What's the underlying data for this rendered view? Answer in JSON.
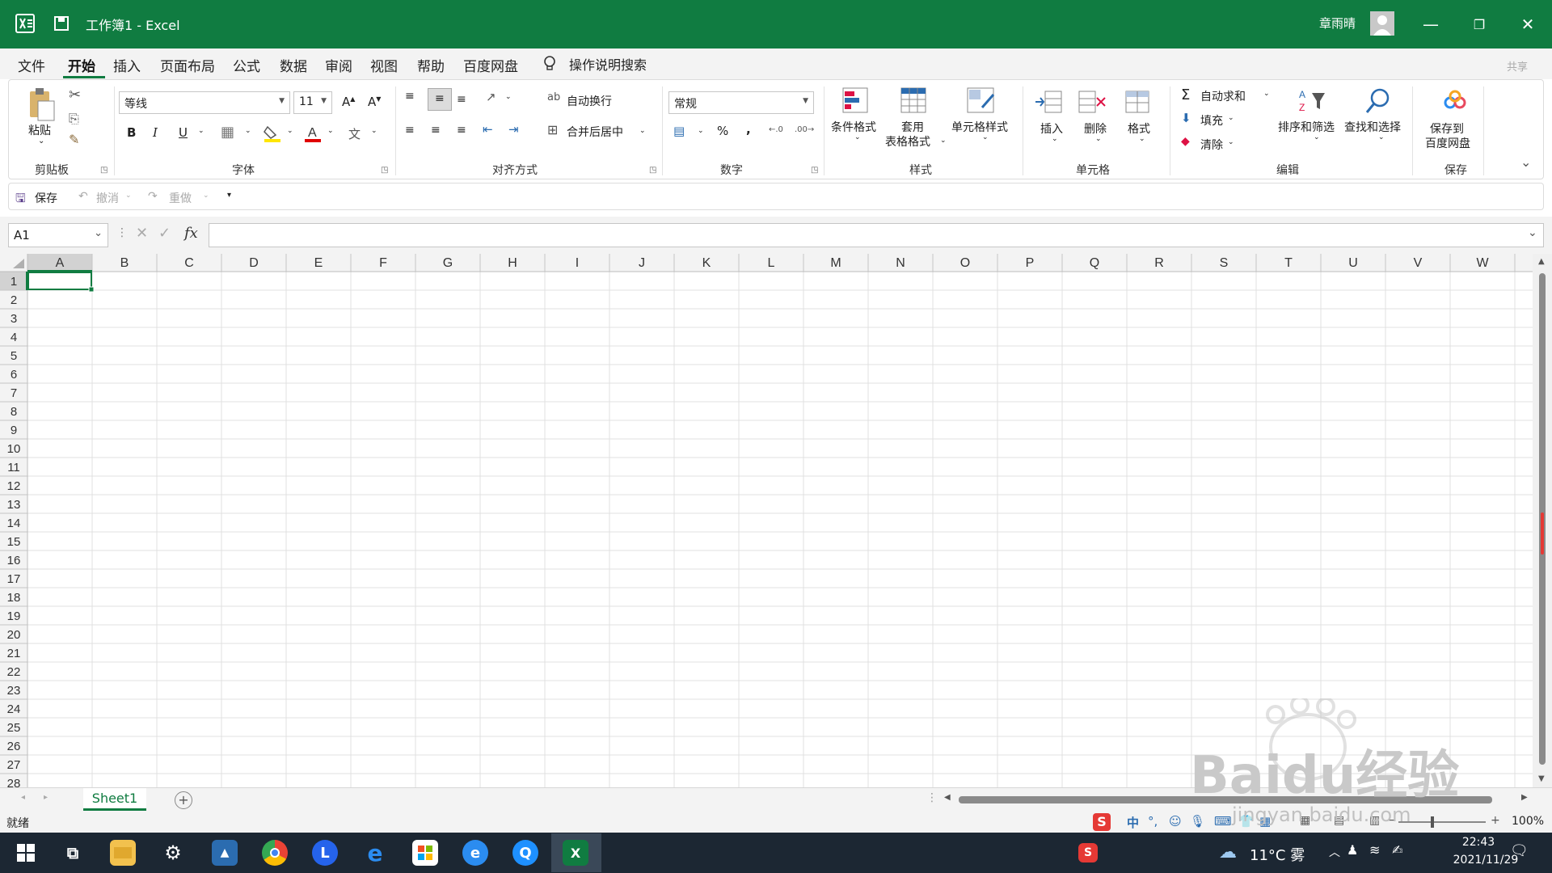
{
  "window": {
    "title": "工作簿1  -  Excel",
    "user": "章雨晴",
    "accent": "#107c41"
  },
  "menu": {
    "tabs": [
      "文件",
      "开始",
      "插入",
      "页面布局",
      "公式",
      "数据",
      "审阅",
      "视图",
      "帮助",
      "百度网盘"
    ],
    "active": "开始",
    "search_label": "操作说明搜索",
    "share": "共享"
  },
  "ribbon": {
    "clipboard": {
      "paste": "粘贴",
      "label": "剪贴板"
    },
    "font": {
      "name": "等线",
      "size": "11",
      "label": "字体",
      "bold": "B",
      "italic": "I",
      "underline": "U"
    },
    "alignment": {
      "wrap": "自动换行",
      "merge": "合并后居中",
      "label": "对齐方式"
    },
    "number": {
      "format": "常规",
      "percent": "%",
      "comma": ",",
      "label": "数字"
    },
    "styles": {
      "conditional": "条件格式",
      "table_1": "套用",
      "table_2": "表格格式",
      "cell_styles": "单元格样式",
      "label": "样式"
    },
    "cells": {
      "insert": "插入",
      "delete": "删除",
      "format": "格式",
      "label": "单元格"
    },
    "editing": {
      "autosum": "自动求和",
      "fill": "填充",
      "clear": "清除",
      "sort": "排序和筛选",
      "find": "查找和选择",
      "label": "编辑"
    },
    "save": {
      "button_1": "保存到",
      "button_2": "百度网盘",
      "label": "保存"
    }
  },
  "qat": {
    "save": "保存",
    "undo": "撤消",
    "redo": "重做"
  },
  "formula_bar": {
    "name_box": "A1",
    "fx": "fx",
    "value": ""
  },
  "grid": {
    "columns": [
      "A",
      "B",
      "C",
      "D",
      "E",
      "F",
      "G",
      "H",
      "I",
      "J",
      "K",
      "L",
      "M",
      "N",
      "O",
      "P",
      "Q",
      "R",
      "S",
      "T",
      "U",
      "V",
      "W"
    ],
    "rows": [
      "1",
      "2",
      "3",
      "4",
      "5",
      "6",
      "7",
      "8",
      "9",
      "10",
      "11",
      "12",
      "13",
      "14",
      "15",
      "16",
      "17",
      "18",
      "19",
      "20",
      "21",
      "22",
      "23",
      "24",
      "25",
      "26",
      "27",
      "28"
    ],
    "selected_cell": "A1"
  },
  "sheets": {
    "tabs": [
      "Sheet1"
    ],
    "active": "Sheet1"
  },
  "status": {
    "text": "就绪",
    "zoom": "100%"
  },
  "taskbar": {
    "weather": "11°C 雾",
    "time": "22:43",
    "date": "2021/11/29",
    "apps": [
      "start-icon",
      "task-view-icon",
      "file-explorer-icon",
      "settings-icon",
      "photos-icon",
      "chrome-icon",
      "l-app-icon",
      "ie-icon",
      "store-icon",
      "edge-icon",
      "qq-browser-icon",
      "excel-icon"
    ]
  },
  "watermark": {
    "text": "Baidu经验",
    "sub": "jingyan.baidu.com"
  }
}
